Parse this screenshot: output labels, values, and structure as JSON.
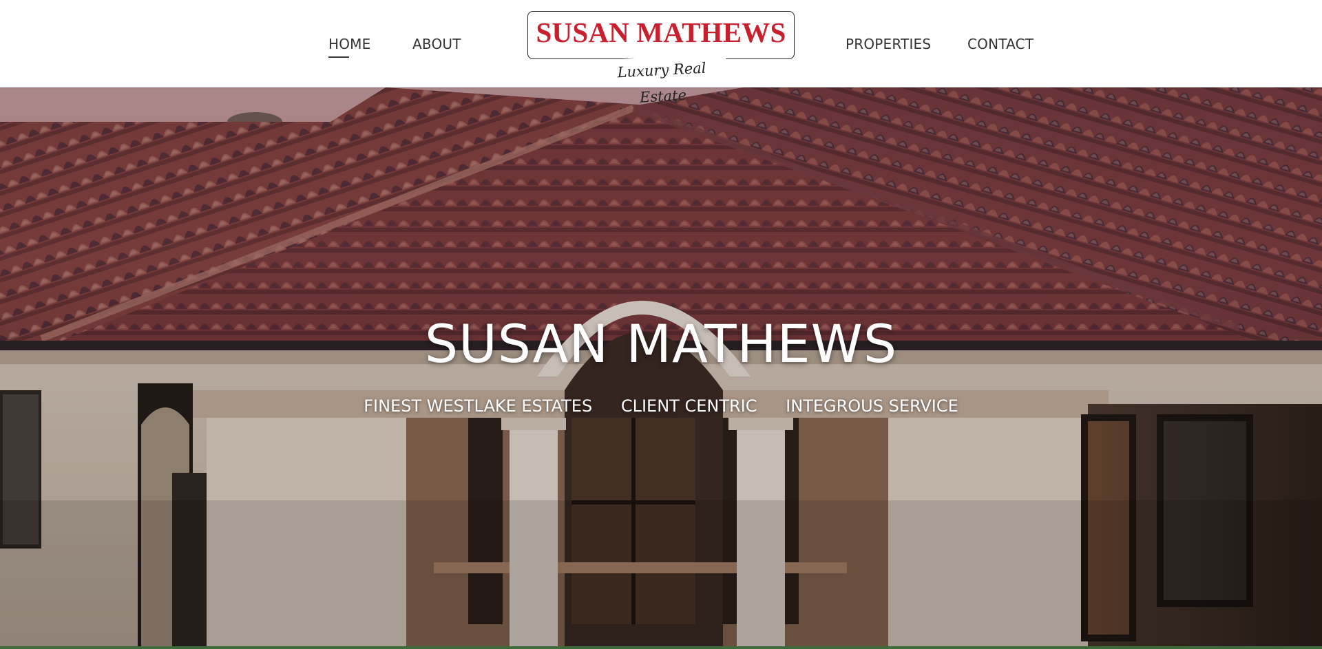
{
  "nav": {
    "home": "HOME",
    "about": "ABOUT",
    "properties": "PROPERTIES",
    "contact": "CONTACT",
    "active": "HOME"
  },
  "logo": {
    "name": "SUSAN MATHEWS",
    "tagline": "Luxury Real Estate",
    "name_color": "#c8202f"
  },
  "hero": {
    "title": "SUSAN MATHEWS",
    "taglines": [
      "FINEST WESTLAKE ESTATES",
      "CLIENT CENTRIC",
      "INTEGROUS SERVICE"
    ]
  }
}
